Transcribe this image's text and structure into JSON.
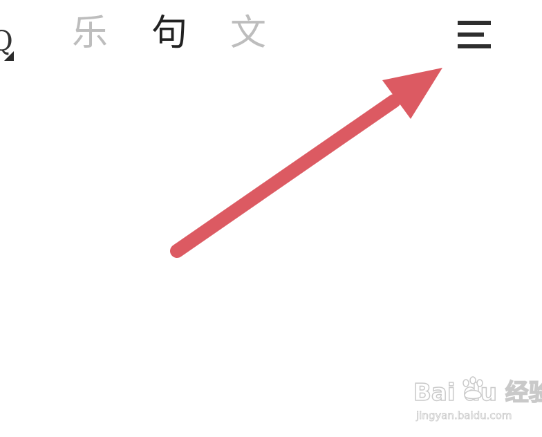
{
  "header": {
    "tabs": [
      {
        "label": "乐",
        "active": false
      },
      {
        "label": "句",
        "active": true
      },
      {
        "label": "文",
        "active": false
      }
    ],
    "menu_icon": "hamburger-menu-icon"
  },
  "annotation": {
    "arrow_color": "#dc5a62",
    "icon": "pointer-arrow-icon"
  },
  "watermark": {
    "logo_text": "Bai du 经验",
    "url": "jingyan.baidu.com"
  },
  "colors": {
    "tab_active": "#222222",
    "tab_inactive": "#bdbdbd",
    "menu_icon": "#2e2e2e",
    "background": "#ffffff"
  }
}
